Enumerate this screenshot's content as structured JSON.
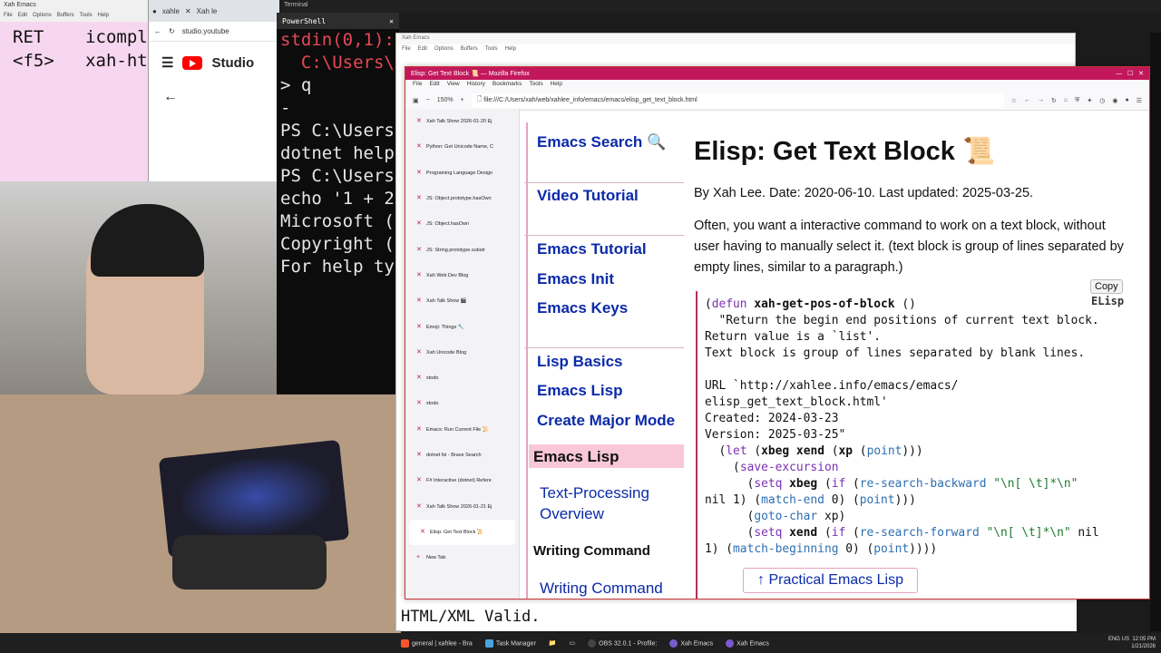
{
  "emacs_left": {
    "title": "Xah Emacs",
    "menu": [
      "File",
      "Edit",
      "Options",
      "Buffers",
      "Tools",
      "Help"
    ],
    "lines": [
      "RET    icompl",
      "<f5>   xah-ht"
    ]
  },
  "chrome": {
    "tabs": [
      "xahle",
      "Xah le"
    ],
    "url": "studio.youtube",
    "brand": "Studio"
  },
  "terminal": {
    "title": "Terminal",
    "tab": "PowerShell",
    "lines": [
      "stdin(0,1):",
      "  C:\\Users\\x",
      "",
      "> q",
      "-",
      "PS C:\\Users",
      "dotnet help",
      "PS C:\\Users",
      "echo '1 + 2",
      "",
      "Microsoft (",
      "Copyright (",
      "",
      "For help ty"
    ]
  },
  "emacs2": {
    "title": "Xah Emacs",
    "menu": [
      "File",
      "Edit",
      "Options",
      "Buffers",
      "Tools",
      "Help"
    ],
    "bottom_line": "HTML/XML Valid."
  },
  "firefox": {
    "title": "Elisp: Get Text Block 📜 — Mozilla Firefox",
    "menu": [
      "File",
      "Edit",
      "View",
      "History",
      "Bookmarks",
      "Tools",
      "Help"
    ],
    "zoom": "150%",
    "url": "file:///C:/Users/xah/web/xahlee_info/emacs/emacs/elisp_get_text_block.html"
  },
  "sidebar_tabs": [
    "Xah Talk Show 2026-01-20 Ej",
    "Python: Get Unicode Name, C",
    "Programing Language Design",
    "JS: Object.prototype.hasOwn",
    "JS: Object.hasOwn",
    "JS: String.prototype.substr",
    "Xah Web Dev Blog",
    "Xah Talk Show 🎬",
    "Emoji: Things 🔧",
    "Xah Unicode Blog",
    "xtodo",
    "xtodo",
    "Emacs: Run Current File 📜",
    "dotnet fsi - Brave Search",
    "F# Interactive (dotnet) Refere",
    "Xah Talk Show 2026-01-21 Ej",
    "Elisp: Get Text Block 📜",
    "New Tab"
  ],
  "page_nav": {
    "links": [
      "Emacs Search 🔍",
      "Video Tutorial",
      "Emacs Tutorial",
      "Emacs Init",
      "Emacs Keys",
      "Lisp Basics",
      "Emacs Lisp",
      "Create Major Mode"
    ],
    "active": "Emacs Lisp",
    "sub1": "Text-Processing",
    "sub1b": "Overview",
    "section": "Writing Command",
    "sub2": "Writing Command"
  },
  "main": {
    "title": "Elisp: Get Text Block 📜",
    "byline": "By Xah Lee. Date: 2020-06-10. Last updated: 2025-03-25.",
    "intro": "Often, you want a interactive command to work on a text block, without user having to manually select it. (text block is group of lines separated by empty lines, similar to a paragraph.)",
    "copy_label": "Copy",
    "lang_label": "ELisp",
    "practical": "↑ Practical Emacs Lisp"
  },
  "taskbar": {
    "items": [
      "general | xahlee - Bra",
      "Task Manager",
      "OBS 32.0.1 - Profile:",
      "Xah Emacs",
      "Xah Emacs"
    ],
    "time": "12:05 PM",
    "date": "1/21/2026",
    "lang": "ENG US"
  }
}
